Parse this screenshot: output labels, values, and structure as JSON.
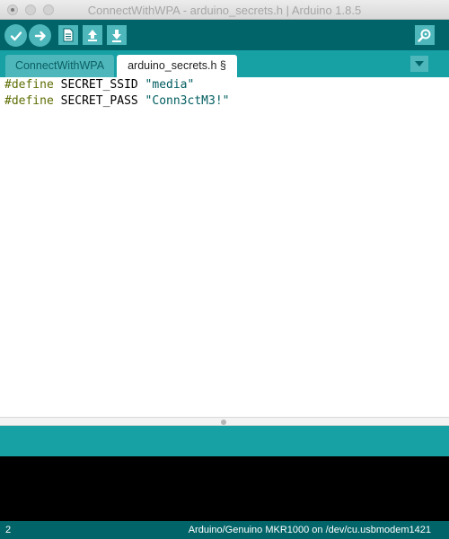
{
  "window": {
    "title": "ConnectWithWPA - arduino_secrets.h | Arduino 1.8.5"
  },
  "toolbar": {
    "buttons": [
      {
        "name": "verify",
        "icon": "checkmark-icon"
      },
      {
        "name": "upload",
        "icon": "arrow-right-icon"
      },
      {
        "name": "new",
        "icon": "new-file-icon"
      },
      {
        "name": "open",
        "icon": "arrow-up-icon"
      },
      {
        "name": "save",
        "icon": "arrow-down-icon"
      },
      {
        "name": "serial-monitor",
        "icon": "magnifier-icon"
      }
    ]
  },
  "tabs": [
    {
      "label": "ConnectWithWPA",
      "active": false
    },
    {
      "label": "arduino_secrets.h §",
      "active": true
    }
  ],
  "editor": {
    "lines": [
      {
        "keyword": "#define",
        "name": "SECRET_SSID",
        "value": "\"media\""
      },
      {
        "keyword": "#define",
        "name": "SECRET_PASS",
        "value": "\"Conn3ctM3!\""
      }
    ]
  },
  "status": {
    "line_number": "2",
    "board_port": "Arduino/Genuino MKR1000 on /dev/cu.usbmodem1421"
  },
  "colors": {
    "toolbar_bg": "#006468",
    "tabbar_bg": "#17a1a5",
    "button_bg": "#4db7bb",
    "keyword": "#5e6d03",
    "string": "#005c5f",
    "console_bg": "#000000"
  }
}
